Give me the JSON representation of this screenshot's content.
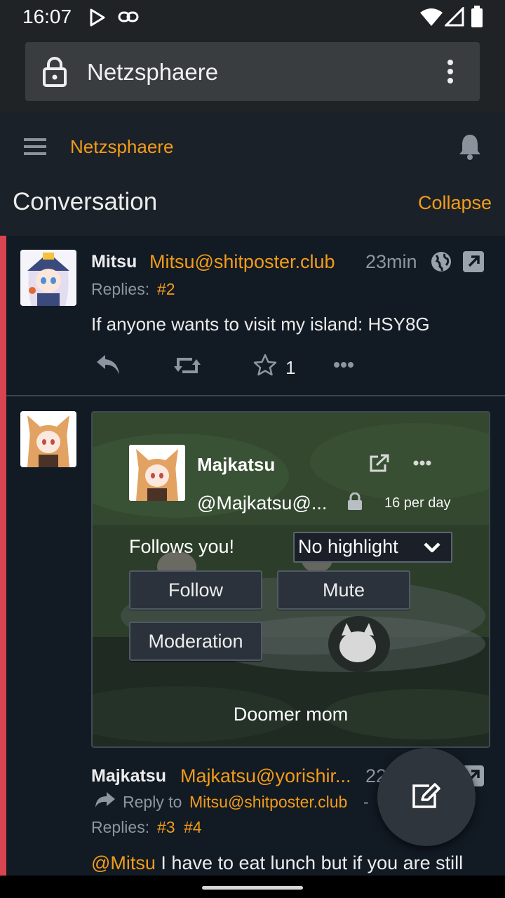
{
  "status": {
    "time": "16:07"
  },
  "browser": {
    "title": "Netzsphaere"
  },
  "app": {
    "title": "Netzsphaere"
  },
  "conversation": {
    "title": "Conversation",
    "collapse_label": "Collapse"
  },
  "post1": {
    "name": "Mitsu",
    "handle": "Mitsu@shitposter.club",
    "time": "23min",
    "replies_label": "Replies:",
    "replies": [
      "#2"
    ],
    "content": "If anyone wants to visit my island: HSY8G",
    "favorite_count": "1"
  },
  "card": {
    "name": "Majkatsu",
    "handle": "@Majkatsu@...",
    "rate": "16 per day",
    "follows_you": "Follows you!",
    "highlight_value": "No highlight",
    "follow_label": "Follow",
    "mute_label": "Mute",
    "moderation_label": "Moderation",
    "bio": "Doomer mom"
  },
  "post2": {
    "name": "Majkatsu",
    "handle": "Majkatsu@yorishir...",
    "time": "22",
    "reply_to_label": "Reply to",
    "reply_to_handle": "Mitsu@shitposter.club",
    "reply_to_suffix": "-",
    "replies_label": "Replies:",
    "replies": [
      "#3",
      "#4"
    ],
    "mention": "@Mitsu",
    "content": " I have to eat lunch but if you are still"
  },
  "colors": {
    "accent": "#f39c18",
    "thread_marker": "#d8444f",
    "background": "#121a24",
    "panel": "#1b2129"
  }
}
